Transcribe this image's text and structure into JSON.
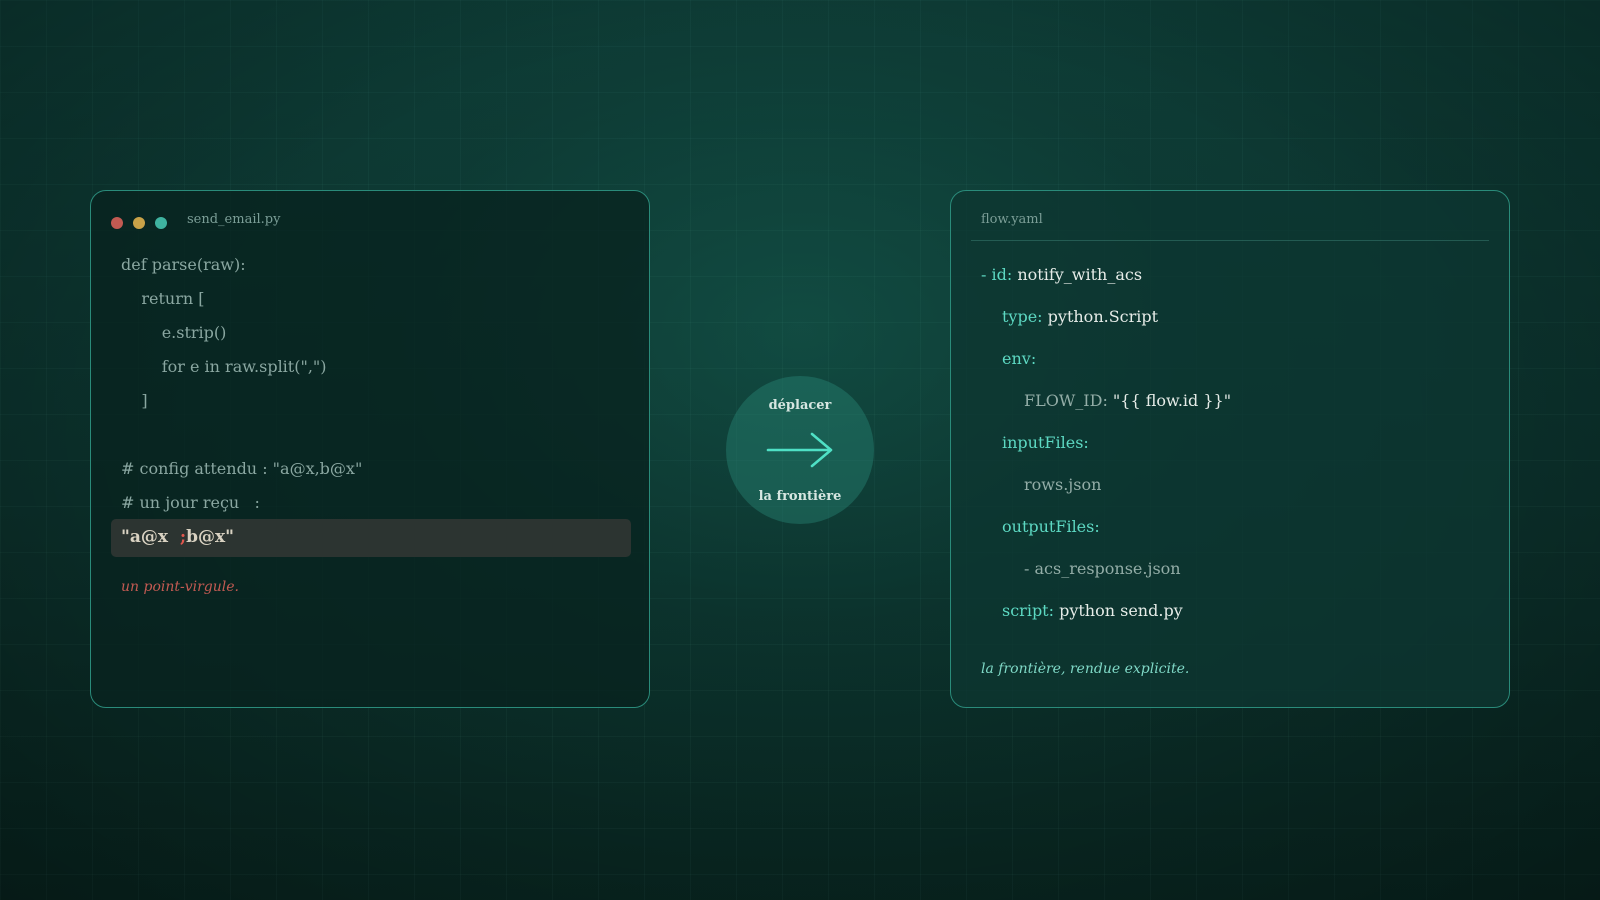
{
  "left_panel": {
    "filename": "send_email.py",
    "code": [
      "def parse(raw):",
      "    return [",
      "        e.strip()",
      "        for e in raw.split(\",\")",
      "    ]",
      "# config attendu : \"a@x,b@x\"",
      "# un jour reçu   :"
    ],
    "received_before": "\"a@x  ",
    "received_semicolon": ";",
    "received_after": "b@x\"",
    "note": "un point-virgule."
  },
  "connector": {
    "top_label": "déplacer",
    "bottom_label": "la frontière",
    "icon": "arrow-right-icon"
  },
  "right_panel": {
    "filename": "flow.yaml",
    "lines": {
      "id_key": "- id:",
      "id_val": " notify_with_acs",
      "type_key": "type:",
      "type_val": " python.Script",
      "env_key": "env:",
      "flow_id_key": "FLOW_ID:",
      "flow_id_val": " \"{{ flow.id }}\"",
      "input_key": "inputFiles:",
      "input_val": "rows.json",
      "output_key": "outputFiles:",
      "output_val": "- acs_response.json",
      "script_key": "script:",
      "script_val": " python send.py"
    },
    "note": "la frontière, rendue explicite."
  },
  "colors": {
    "background": "#0b2f2a",
    "border": "#2a8b7a",
    "yaml_key": "#5dd9c3",
    "warning": "#c25a52",
    "accent_arrow": "#4fe0c5"
  }
}
